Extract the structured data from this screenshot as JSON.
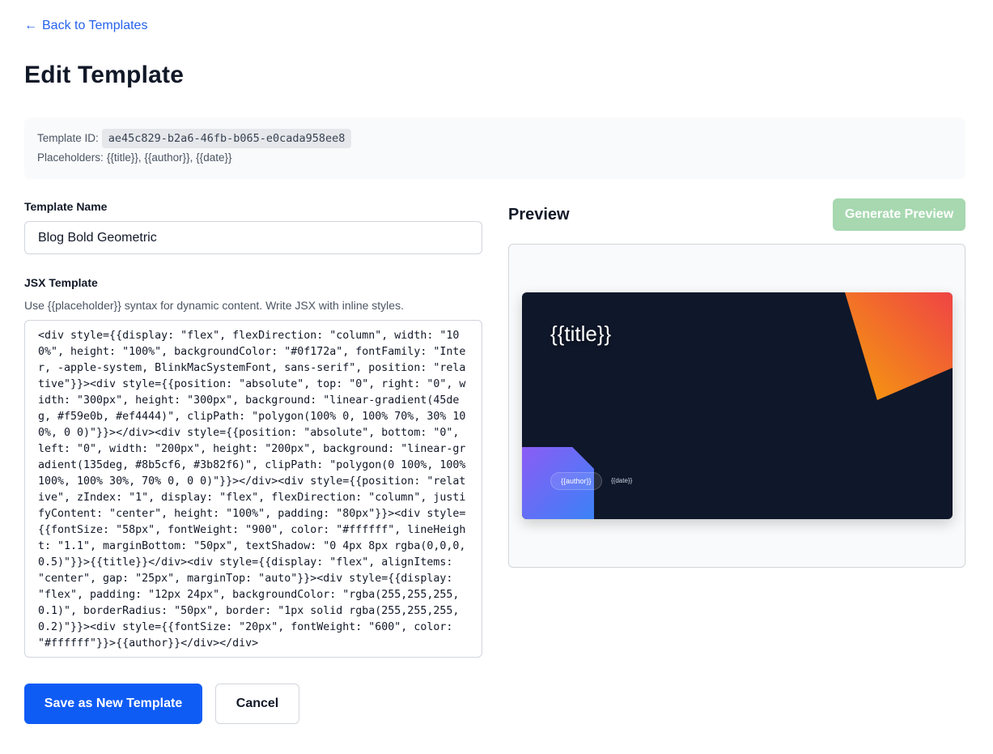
{
  "nav": {
    "back_arrow": "←",
    "back_label": "Back to Templates"
  },
  "page": {
    "title": "Edit Template"
  },
  "info": {
    "template_id_label": "Template ID:",
    "template_id": "ae45c829-b2a6-46fb-b065-e0cada958ee8",
    "placeholders_label": "Placeholders:",
    "placeholders": "{{title}}, {{author}}, {{date}}"
  },
  "form": {
    "name_label": "Template Name",
    "name_value": "Blog Bold Geometric",
    "jsx_label": "JSX Template",
    "jsx_help": "Use {{placeholder}} syntax for dynamic content. Write JSX with inline styles.",
    "jsx_value": "<div style={{display: \"flex\", flexDirection: \"column\", width: \"100%\", height: \"100%\", backgroundColor: \"#0f172a\", fontFamily: \"Inter, -apple-system, BlinkMacSystemFont, sans-serif\", position: \"relative\"}}><div style={{position: \"absolute\", top: \"0\", right: \"0\", width: \"300px\", height: \"300px\", background: \"linear-gradient(45deg, #f59e0b, #ef4444)\", clipPath: \"polygon(100% 0, 100% 70%, 30% 100%, 0 0)\"}}></div><div style={{position: \"absolute\", bottom: \"0\", left: \"0\", width: \"200px\", height: \"200px\", background: \"linear-gradient(135deg, #8b5cf6, #3b82f6)\", clipPath: \"polygon(0 100%, 100% 100%, 100% 30%, 70% 0, 0 0)\"}}></div><div style={{position: \"relative\", zIndex: \"1\", display: \"flex\", flexDirection: \"column\", justifyContent: \"center\", height: \"100%\", padding: \"80px\"}}><div style={{fontSize: \"58px\", fontWeight: \"900\", color: \"#ffffff\", lineHeight: \"1.1\", marginBottom: \"50px\", textShadow: \"0 4px 8px rgba(0,0,0,0.5)\"}}>{{title}}</div><div style={{display: \"flex\", alignItems: \"center\", gap: \"25px\", marginTop: \"auto\"}}><div style={{display: \"flex\", padding: \"12px 24px\", backgroundColor: \"rgba(255,255,255,0.1)\", borderRadius: \"50px\", border: \"1px solid rgba(255,255,255,0.2)\"}}><div style={{fontSize: \"20px\", fontWeight: \"600\", color: \"#ffffff\"}}>{{author}}</div></div>"
  },
  "actions": {
    "save_label": "Save as New Template",
    "cancel_label": "Cancel"
  },
  "preview": {
    "title": "Preview",
    "generate_label": "Generate Preview",
    "card": {
      "title": "{{title}}",
      "author": "{{author}}",
      "date": "{{date}}"
    }
  },
  "colors": {
    "link": "#2563eb",
    "primary": "#0f5cf5",
    "generate_disabled": "#a7d8b0",
    "card_bg": "#0f172a"
  }
}
